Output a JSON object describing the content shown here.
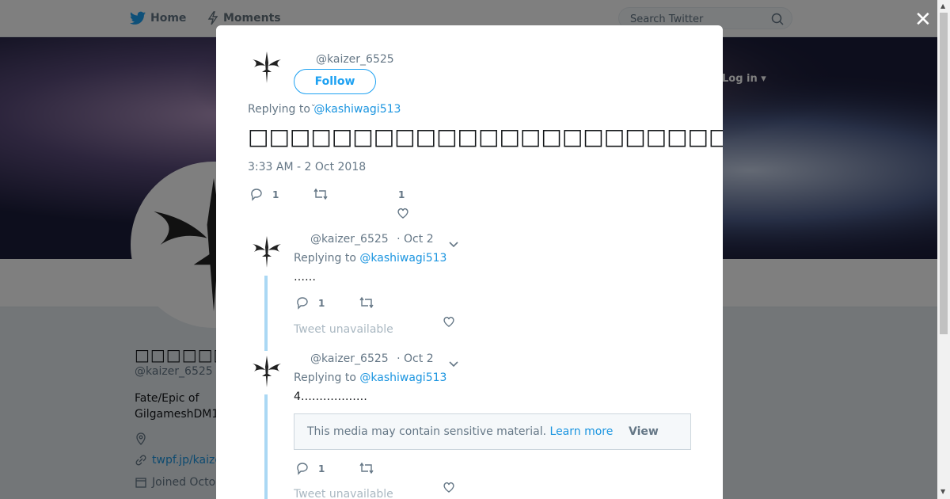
{
  "topbar": {
    "home_label": "Home",
    "moments_label": "Moments",
    "search_placeholder": "Search Twitter",
    "login_label": "Log in ▾"
  },
  "profile": {
    "name": "□□□□□□□□",
    "handle": "@kaizer_6525",
    "bio": "Fate/Epic of GilgameshDM1",
    "url": "twpf.jp/kaize",
    "joined": "Joined Octo"
  },
  "modal": {
    "handle": "@kaizer_6525",
    "follow_label": "Follow",
    "replying_prefix": "Replying to",
    "replying_to": "@kashiwagi513",
    "tweet_text": "□□□□□□□□□□□□□□□□□□□□□□□",
    "timestamp": "3:33 AM - 2 Oct 2018",
    "reply_count": "1",
    "like_count": "1",
    "thread": [
      {
        "handle": "@kaizer_6525",
        "date": "· Oct 2",
        "replying_prefix": "Replying to",
        "replying_to": "@kashiwagi513",
        "text": "……",
        "reply_count": "1",
        "unavailable": "Tweet unavailable"
      },
      {
        "handle": "@kaizer_6525",
        "date": "· Oct 2",
        "replying_prefix": "Replying to",
        "replying_to": "@kashiwagi513",
        "text": "4………………",
        "sensitive_msg": "This media may contain sensitive material.",
        "learn_more": "Learn more",
        "view_label": "View",
        "reply_count": "1",
        "unavailable": "Tweet unavailable"
      }
    ]
  },
  "colors": {
    "accent": "#1da1f2",
    "link": "#1b95e0",
    "muted": "#657786",
    "thread_line": "#aad8f4"
  }
}
